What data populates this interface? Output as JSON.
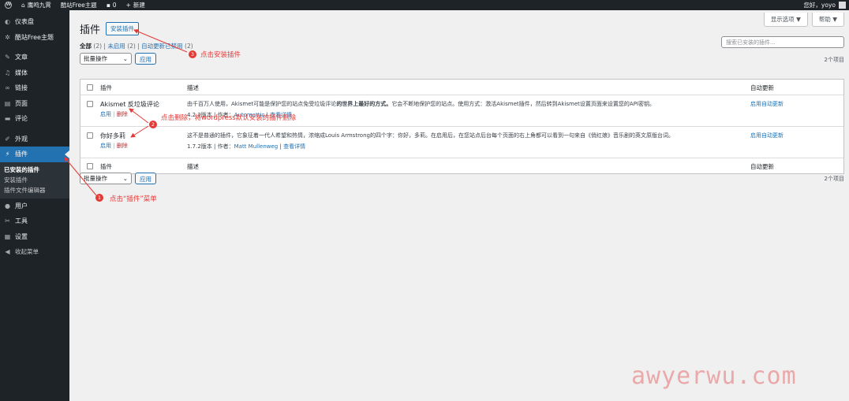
{
  "adminbar": {
    "site_name": "鹰鸣九霄",
    "theme_link": "酷站Free主题",
    "comments_count": "0",
    "new_label": "新建",
    "greeting": "您好，yoyo"
  },
  "sidebar": {
    "items": [
      {
        "label": "仪表盘",
        "icon": "dashboard-icon"
      },
      {
        "label": "酷站Free主题",
        "icon": "gear-icon"
      },
      {
        "label": "文章",
        "icon": "pin-icon"
      },
      {
        "label": "媒体",
        "icon": "media-icon"
      },
      {
        "label": "链接",
        "icon": "link-icon"
      },
      {
        "label": "页面",
        "icon": "page-icon"
      },
      {
        "label": "评论",
        "icon": "comment-icon"
      },
      {
        "label": "外观",
        "icon": "brush-icon"
      },
      {
        "label": "插件",
        "icon": "plugin-icon"
      },
      {
        "label": "用户",
        "icon": "user-icon"
      },
      {
        "label": "工具",
        "icon": "wrench-icon"
      },
      {
        "label": "设置",
        "icon": "settings-icon"
      },
      {
        "label": "收起菜单",
        "icon": "collapse-icon"
      }
    ],
    "submenu": [
      "已安装的插件",
      "安装插件",
      "插件文件编辑器"
    ]
  },
  "header": {
    "screen_options": "显示选项 ▼",
    "help": "帮助 ▼",
    "title": "插件",
    "add_new": "安装插件"
  },
  "filters": {
    "all": "全部",
    "all_count": "(2)",
    "inactive": "未启用",
    "inactive_count": "(2)",
    "autoupdate_disabled": "自动更新已禁用",
    "autoupdate_count": "(2)"
  },
  "search": {
    "placeholder": "搜索已安装的插件..."
  },
  "tablenav": {
    "bulk_label": "批量操作",
    "apply_label": "应用",
    "items_count": "2个项目"
  },
  "table": {
    "headers": {
      "name": "插件",
      "description": "描述",
      "auto_update": "自动更新"
    },
    "plugins": [
      {
        "name": "Akismet 反垃圾评论",
        "activate": "启用",
        "delete": "删除",
        "desc_pre": "由千百万人使用，Akismet可能是保护您的站点免受垃圾评论",
        "desc_bold": "的世界上最好的方式。",
        "desc_post": "它会不断地保护您的站点。使用方式：激活Akismet插件，然后转到Akismet设置页面来设置您的API密钥。",
        "version": "4.2.2版本",
        "author_label": "作者：",
        "author": "Automattic",
        "details": "查看详情",
        "auto_update": "启用自动更新"
      },
      {
        "name": "你好多莉",
        "activate": "启用",
        "delete": "删除",
        "desc_pre": "这不是普通的插件，它象征着一代人希望和热情，浓缩成Louis Armstrong的四个字：你好，多莉。在启用后，在您站点后台每个页面的右上角都可以看到一句来自《俏红娘》音乐剧的英文原版台词。",
        "desc_bold": "",
        "desc_post": "",
        "version": "1.7.2版本",
        "author_label": "作者：",
        "author": "Matt Mullenweg",
        "details": "查看详情",
        "auto_update": "启用自动更新"
      }
    ]
  },
  "annotations": {
    "install_text": "点击安装插件",
    "install_num": "3",
    "delete_text": "点击删除，将wordpress默认安装的插件删除",
    "delete_num": "2",
    "menu_text": "点击“插件”菜单",
    "menu_num": "1",
    "color": "#e53935"
  },
  "watermark": "awyerwu.com"
}
